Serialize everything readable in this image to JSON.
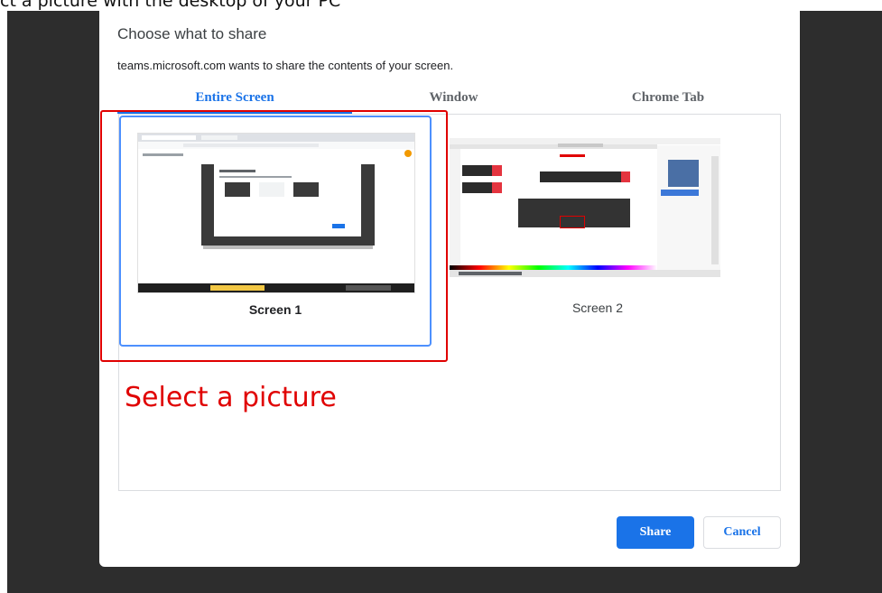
{
  "caption": "ct a picture with the desktop of your PC",
  "dialog": {
    "title": "Choose what to share",
    "subtitle": "teams.microsoft.com wants to share the contents of your screen."
  },
  "tabs": [
    {
      "label": "Entire Screen",
      "selected": true
    },
    {
      "label": "Window",
      "selected": false
    },
    {
      "label": "Chrome Tab",
      "selected": false
    }
  ],
  "screens": [
    {
      "label": "Screen 1",
      "selected": true
    },
    {
      "label": "Screen 2",
      "selected": false
    }
  ],
  "annotation": "Select a picture",
  "buttons": {
    "share": "Share",
    "cancel": "Cancel"
  },
  "colors": {
    "accent": "#1a73e8",
    "annotation_red": "#e00000",
    "backdrop": "#2d2d2d"
  }
}
